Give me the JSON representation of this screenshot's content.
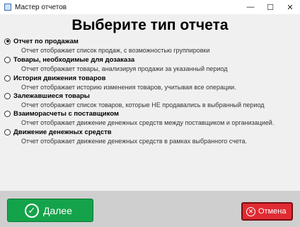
{
  "window": {
    "title": "Мастер отчетов",
    "minimize": "—",
    "maximize": "☐",
    "close": "✕"
  },
  "heading": "Выберите тип отчета",
  "selected_option": 0,
  "options": [
    {
      "title": "Отчет по продажам",
      "description": "Отчет отображает список продаж, с возможностью группировки"
    },
    {
      "title": "Товары, необходимые для дозаказа",
      "description": "Отчет отображает товары, анализируя продажи  за указанный период"
    },
    {
      "title": "История движения товаров",
      "description": "Отчет отображает историю изменения товаров, учитывая все операции."
    },
    {
      "title": "Залежавшиеся товары",
      "description": "Отчет отображает список товаров, которые НЕ продавались в выбранный период"
    },
    {
      "title": "Взаиморасчеты с поставщиком",
      "description": "Отчет отображает движение денежных средств между поставщиком и организацией."
    },
    {
      "title": "Движение денежных средств",
      "description": "Отчет отображает движение денежных средств в рамках выбранного  счета."
    }
  ],
  "buttons": {
    "next_label": "Далее",
    "next_icon": "✓",
    "cancel_label": "Отмена",
    "cancel_icon": "✕"
  },
  "colors": {
    "content_bg": "#f0f0f0",
    "footer_bg": "#cfcfcf",
    "next_button": "#14a34a",
    "cancel_button": "#e02b33"
  }
}
